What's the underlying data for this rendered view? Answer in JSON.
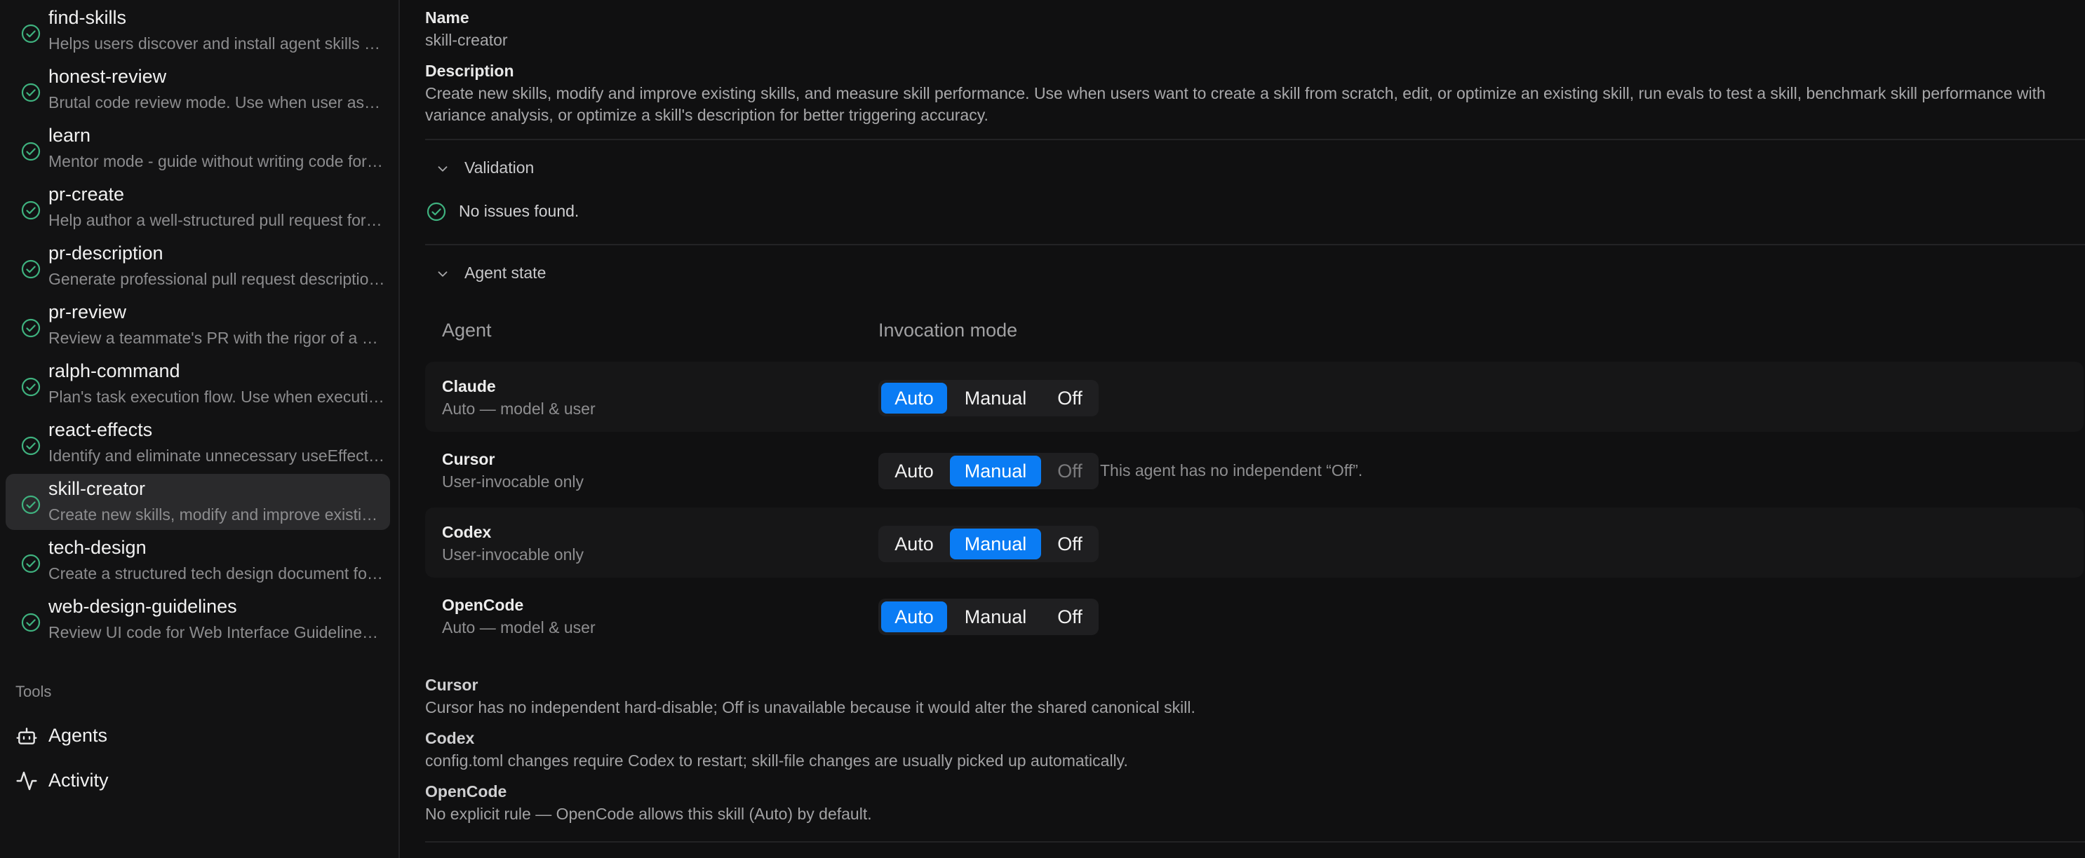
{
  "sidebar": {
    "skills": [
      {
        "name": "find-skills",
        "description": "Helps users discover and install agent skills when they ask questions like \"how do I do X\"",
        "selected": false
      },
      {
        "name": "honest-review",
        "description": "Brutal code review mode. Use when user asks for an honest review",
        "selected": false
      },
      {
        "name": "learn",
        "description": "Mentor mode - guide without writing code for the user",
        "selected": false
      },
      {
        "name": "pr-create",
        "description": "Help author a well-structured pull request for the current branch",
        "selected": false
      },
      {
        "name": "pr-description",
        "description": "Generate professional pull request descriptions from the diff",
        "selected": false
      },
      {
        "name": "pr-review",
        "description": "Review a teammate's PR with the rigor of a senior engineer",
        "selected": false
      },
      {
        "name": "ralph-command",
        "description": "Plan's task execution flow. Use when executing a plan",
        "selected": false
      },
      {
        "name": "react-effects",
        "description": "Identify and eliminate unnecessary useEffect calls in React code",
        "selected": false
      },
      {
        "name": "skill-creator",
        "description": "Create new skills, modify and improve existing skills",
        "selected": true
      },
      {
        "name": "tech-design",
        "description": "Create a structured tech design document for a feature",
        "selected": false
      },
      {
        "name": "web-design-guidelines",
        "description": "Review UI code for Web Interface Guidelines compliance",
        "selected": false
      }
    ],
    "tools_heading": "Tools",
    "tools": [
      {
        "label": "Agents",
        "icon": "robot-icon"
      },
      {
        "label": "Activity",
        "icon": "activity-icon"
      }
    ]
  },
  "main": {
    "name_label": "Name",
    "name_value": "skill-creator",
    "description_label": "Description",
    "description_value": "Create new skills, modify and improve existing skills, and measure skill performance. Use when users want to create a skill from scratch, edit, or optimize an existing skill, run evals to test a skill, benchmark skill performance with variance analysis, or optimize a skill's description for better triggering accuracy.",
    "validation": {
      "title": "Validation",
      "status": "No issues found."
    },
    "agent_state": {
      "title": "Agent state",
      "col_agent": "Agent",
      "col_mode": "Invocation mode",
      "mode_labels": {
        "auto": "Auto",
        "manual": "Manual",
        "off": "Off"
      },
      "rows": [
        {
          "agent": "Claude",
          "subtitle": "Auto — model & user",
          "selected": "auto",
          "off_disabled": false,
          "note": ""
        },
        {
          "agent": "Cursor",
          "subtitle": "User-invocable only",
          "selected": "manual",
          "off_disabled": true,
          "note": "This agent has no independent “Off”."
        },
        {
          "agent": "Codex",
          "subtitle": "User-invocable only",
          "selected": "manual",
          "off_disabled": false,
          "note": ""
        },
        {
          "agent": "OpenCode",
          "subtitle": "Auto — model & user",
          "selected": "auto",
          "off_disabled": false,
          "note": ""
        }
      ]
    },
    "notes": [
      {
        "label": "Cursor",
        "text": "Cursor has no independent hard-disable; Off is unavailable because it would alter the shared canonical skill."
      },
      {
        "label": "Codex",
        "text": "config.toml changes require Codex to restart; skill-file changes are usually picked up automatically."
      },
      {
        "label": "OpenCode",
        "text": "No explicit rule — OpenCode allows this skill (Auto) by default."
      }
    ]
  },
  "colors": {
    "accent": "#0a7cf4",
    "check_green": "#3fb27f",
    "background": "#101011",
    "sidebar_bg": "#121213",
    "selected_bg": "#2a2a2c"
  }
}
